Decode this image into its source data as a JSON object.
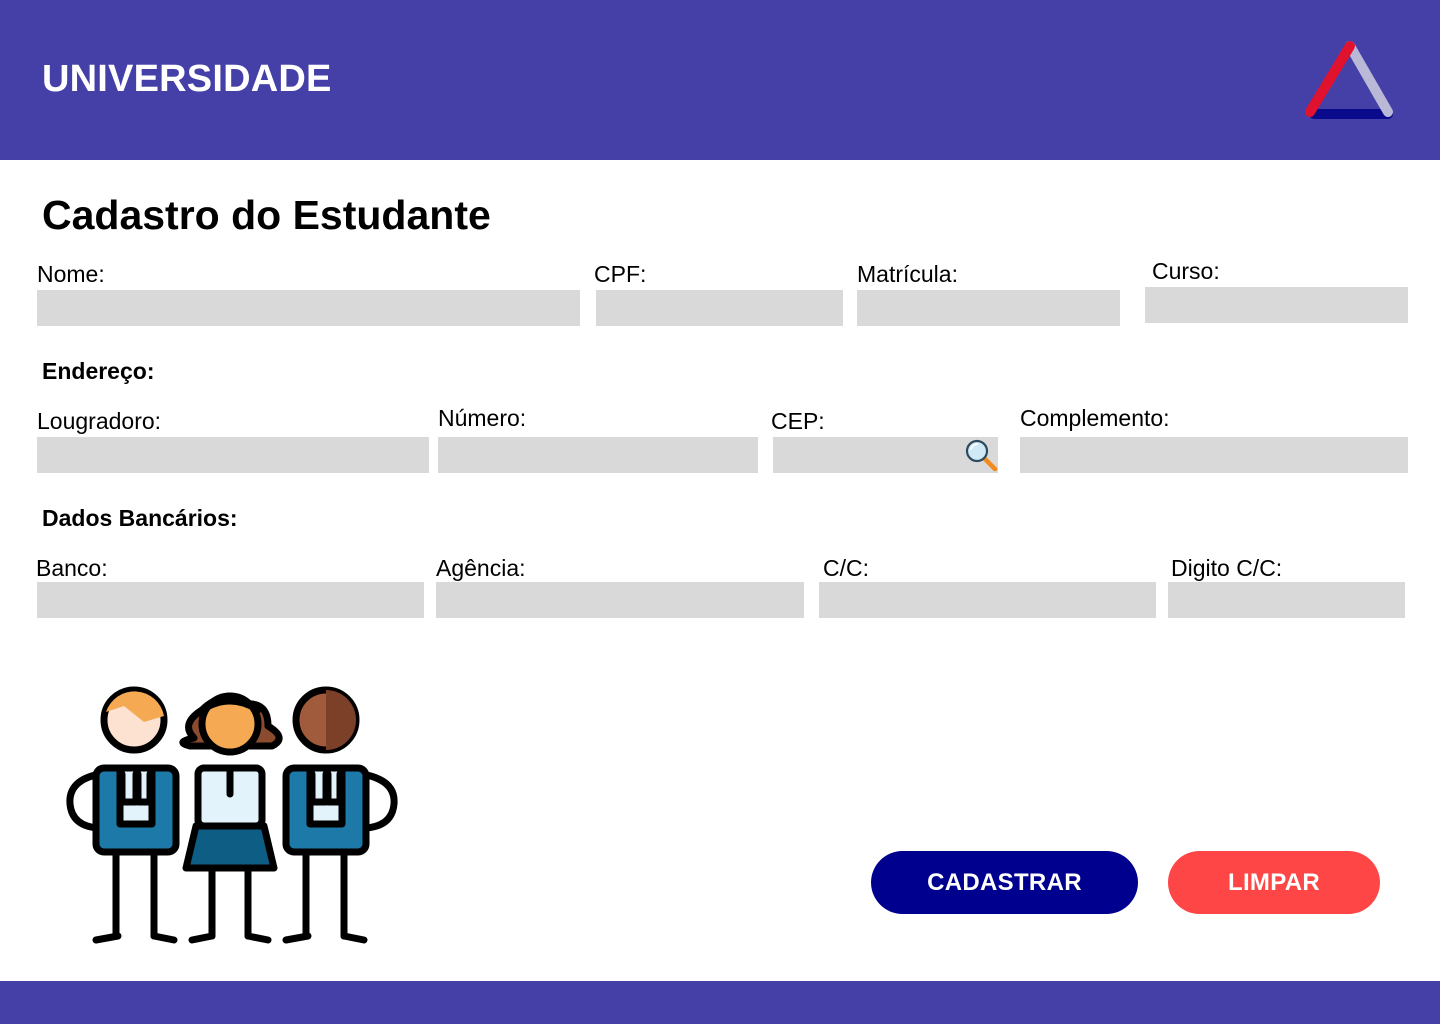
{
  "header": {
    "brand": "UNIVERSIDADE",
    "logo_icon": "triangle-logo-icon",
    "background": "#4440a8"
  },
  "form": {
    "title": "Cadastro do Estudante",
    "personal": {
      "nome_label": "Nome:",
      "cpf_label": "CPF:",
      "matricula_label": "Matrícula:",
      "curso_label": "Curso:"
    },
    "address": {
      "section_title": "Endereço:",
      "logradouro_label": "Lougradoro:",
      "numero_label": "Número:",
      "cep_label": "CEP:",
      "cep_search_icon": "magnifier-icon",
      "complemento_label": "Complemento:"
    },
    "bank": {
      "section_title": "Dados Bancários:",
      "banco_label": "Banco:",
      "agencia_label": "Agência:",
      "cc_label": "C/C:",
      "digito_label": "Digito C/C:"
    },
    "field_color": "#d9d9d9"
  },
  "illustration": {
    "icon": "students-group-icon"
  },
  "actions": {
    "submit_label": "CADASTRAR",
    "submit_color": "#00008f",
    "clear_label": "LIMPAR",
    "clear_color": "#ff4646"
  }
}
